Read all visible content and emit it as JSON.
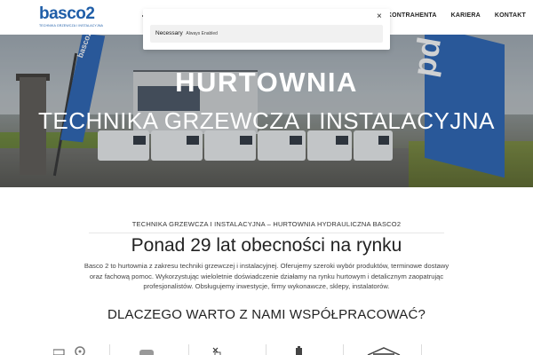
{
  "header": {
    "logo": {
      "word": "basco2",
      "tagline": "TECHNIKA GRZEWCZA I INSTALACYJNA"
    },
    "nav": [
      "KONTRAHENTA",
      "KARIERA",
      "KONTAKT"
    ]
  },
  "hero": {
    "title": "HURTOWNIA",
    "subtitle": "TECHNIKA GRZEWCZA I INSTALACYJNA",
    "flag_left_text": "basco2",
    "flag_right_text": "pd"
  },
  "cookie": {
    "category": "Necessary",
    "state": "Always Enabled",
    "close_symbol": "×"
  },
  "content": {
    "section_label": "TECHNIKA GRZEWCZA I INSTALACYJNA – HURTOWNIA HYDRAULICZNA BASCO2",
    "headline": "Ponad 29 lat obecności na rynku",
    "body": "Basco 2 to hurtownia z zakresu techniki grzewczej i instalacyjnej. Oferujemy szeroki wybór produktów, terminowe dostawy oraz fachową pomoc. Wykorzystując wieloletnie doświadczenie działamy na rynku hurtowym i detalicznym zaopatrując profesjonalistów. Obsługujemy inwestycje, firmy wykonawcze, sklepy, instalatorów.",
    "why_heading": "DLACZEGO WARTO Z NAMI WSPÓŁPRACOWAĆ?"
  },
  "features": {
    "icons": [
      "truck-gear-icon",
      "box-icon",
      "tools-icon",
      "cylinder-icon",
      "warehouse-icon"
    ]
  },
  "colors": {
    "brand": "#1f5ea8",
    "flag": "#2a64b6"
  }
}
